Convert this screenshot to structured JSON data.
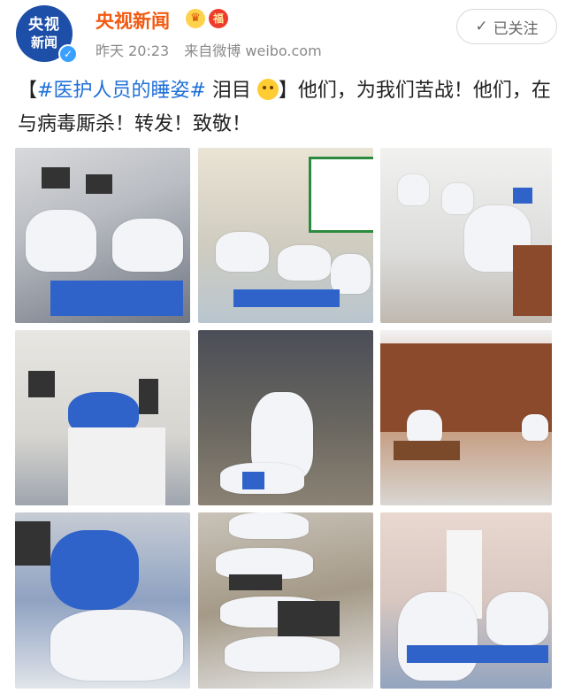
{
  "account": {
    "avatar_line1": "央视",
    "avatar_line2": "新闻",
    "name": "央视新闻",
    "badge_crown": "♛",
    "badge_fu": "福",
    "time": "昨天 20:23",
    "source": "来自微博 weibo.com"
  },
  "follow_button": {
    "icon": "✓",
    "label": "已关注"
  },
  "post": {
    "hashtag_open": "【",
    "hashtag": "#医护人员的睡姿#",
    "tearful": "泪目",
    "rest": "】他们，为我们苦战！他们，在与病毒厮杀！转发！致敬！"
  },
  "photos": [
    "photo-1",
    "photo-2",
    "photo-3",
    "photo-4",
    "photo-5",
    "photo-6",
    "photo-7",
    "photo-8",
    "photo-9"
  ]
}
